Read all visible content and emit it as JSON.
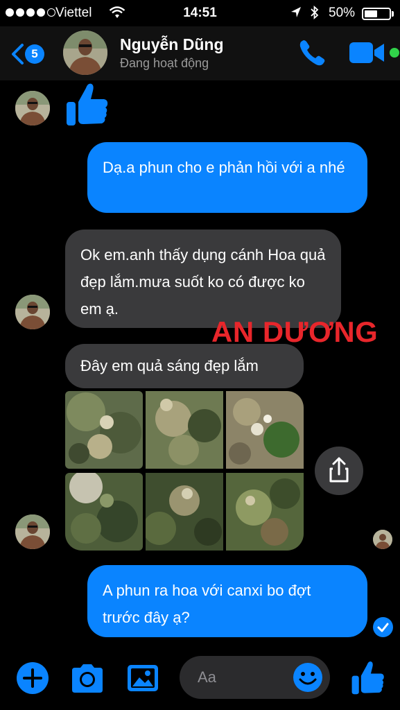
{
  "status_bar": {
    "carrier": "Viettel",
    "time": "14:51",
    "battery": "50%",
    "battery_level": 0.5
  },
  "header": {
    "back_badge": "5",
    "contact_name": "Nguyễn Dũng",
    "contact_status": "Đang hoạt động",
    "accent_color": "#0a84ff",
    "online_color": "#31d24a"
  },
  "messages": [
    {
      "direction": "outgoing",
      "text": "Dạ.a phun cho e phản hồi với a nhé"
    },
    {
      "direction": "incoming",
      "text": "Ok em.anh thấy dụng cánh Hoa quả đẹp lắm.mưa suốt ko có được ko em ạ."
    },
    {
      "direction": "incoming",
      "text": "Đây em quả sáng đẹp lắm"
    },
    {
      "direction": "outgoing",
      "text": "A phun ra hoa với canxi bo đợt trước đây ạ?"
    }
  ],
  "watermark": "AN DƯƠNG",
  "photos_count": 6,
  "composer": {
    "placeholder": "Aa"
  },
  "icons": {
    "back": "chevron-left-icon",
    "call": "phone-icon",
    "video": "video-camera-icon",
    "like": "thumbs-up-icon",
    "share": "share-icon",
    "add": "plus-icon",
    "camera": "camera-icon",
    "gallery": "image-icon",
    "emoji": "smiley-icon",
    "delivered": "check-circle-icon"
  }
}
